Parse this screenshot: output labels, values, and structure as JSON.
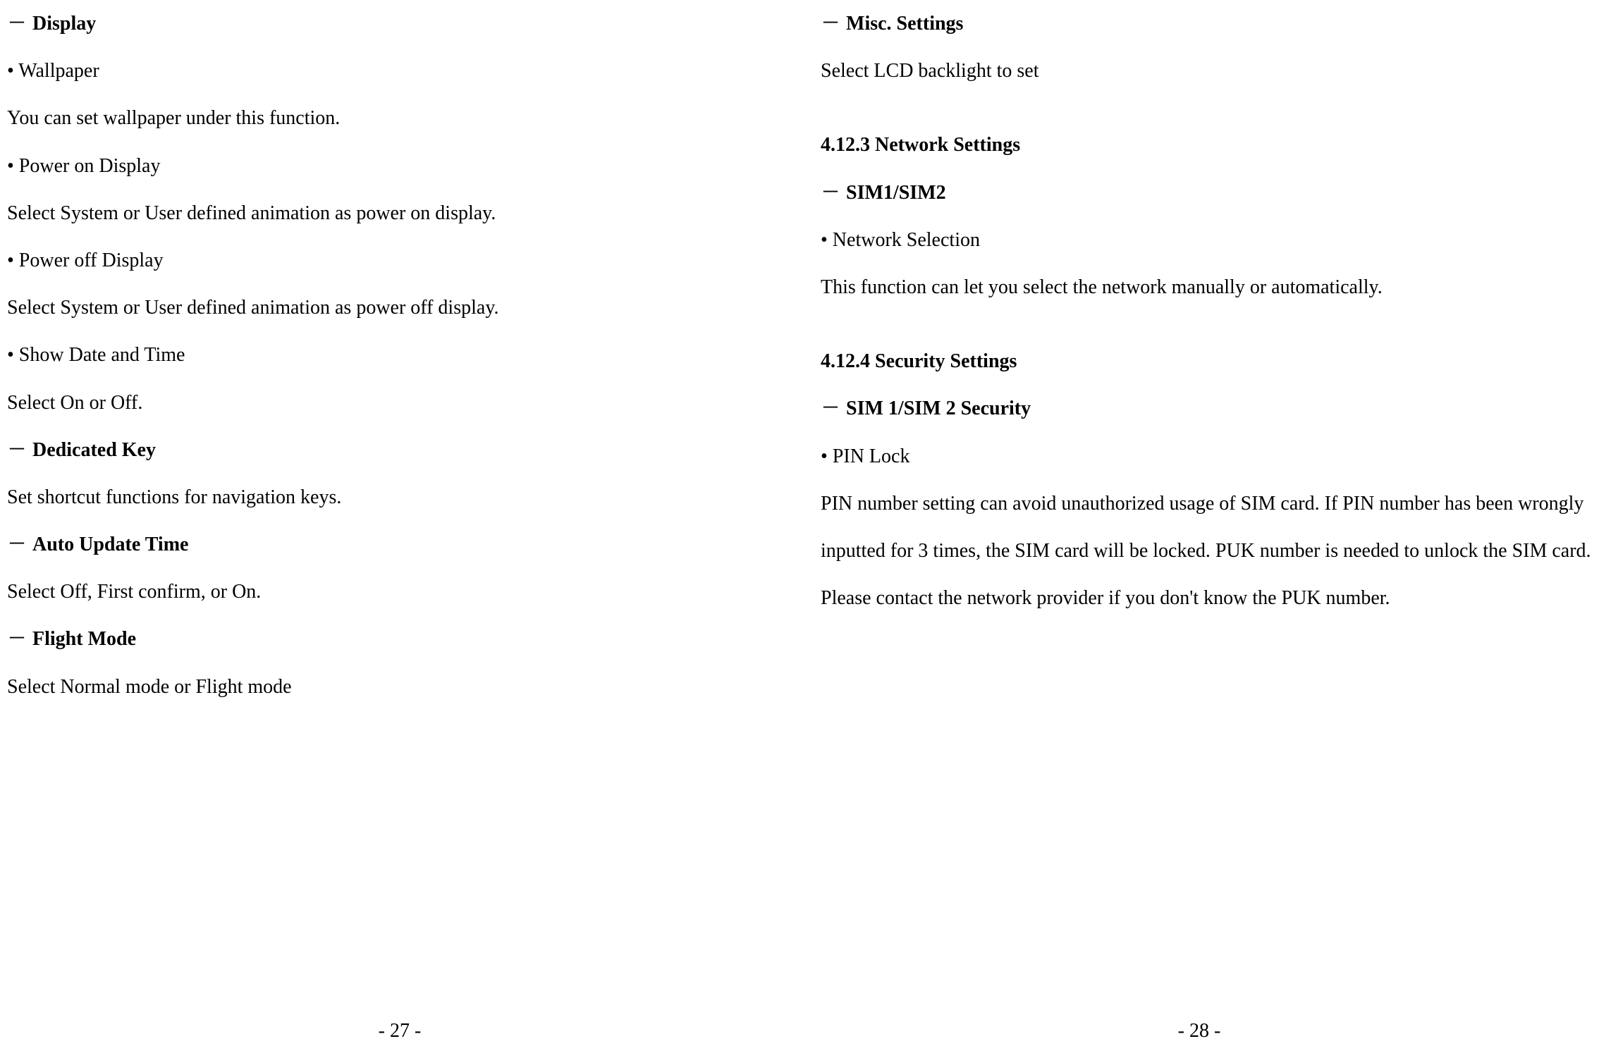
{
  "left": {
    "display_heading": "Display",
    "wallpaper_bullet": "• Wallpaper",
    "wallpaper_text": "You can set wallpaper under this function.",
    "poweron_bullet": "• Power on Display",
    "poweron_text": "Select System or User defined animation as power on display.",
    "poweroff_bullet": "• Power off Display",
    "poweroff_text": "Select System or User defined animation as power off display.",
    "showdate_bullet": "• Show Date and Time",
    "showdate_text": "Select On or Off.",
    "dedicated_heading": "Dedicated Key",
    "dedicated_text": "Set shortcut functions for navigation keys.",
    "autoupdate_heading": "Auto Update Time",
    "autoupdate_text": "Select Off, First confirm, or On.",
    "flight_heading": "Flight Mode",
    "flight_text": "Select Normal mode or Flight mode",
    "page_number": "- 27 -"
  },
  "right": {
    "misc_heading": "Misc. Settings",
    "misc_text": "Select LCD backlight to set",
    "network_section": "4.12.3 Network Settings",
    "sim_heading": "SIM1/SIM2",
    "network_bullet": "• Network Selection",
    "network_text": "This function can let you select the network manually or automatically.",
    "security_section": "4.12.4 Security Settings",
    "simsec_heading": "SIM 1/SIM 2 Security",
    "pin_bullet": "• PIN Lock",
    "pin_text": "PIN number setting can avoid unauthorized usage of SIM card. If PIN number has been wrongly inputted for 3 times, the SIM card will be locked. PUK number is needed to unlock the SIM card. Please contact the network provider if you don't know the PUK number.",
    "page_number": "- 28 -"
  },
  "dash": "－"
}
